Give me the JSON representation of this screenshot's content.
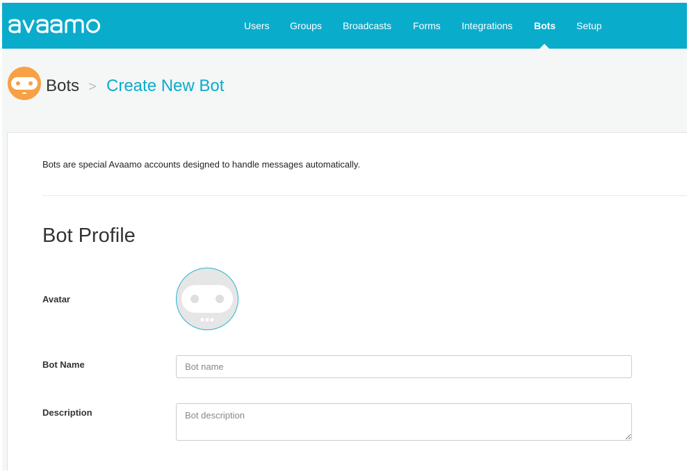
{
  "app": {
    "logo_text": "avaamo",
    "brand_color": "#0aaccc",
    "accent_orange": "#f7a144"
  },
  "nav": {
    "items": [
      {
        "label": "Users",
        "active": false
      },
      {
        "label": "Groups",
        "active": false
      },
      {
        "label": "Broadcasts",
        "active": false
      },
      {
        "label": "Forms",
        "active": false
      },
      {
        "label": "Integrations",
        "active": false
      },
      {
        "label": "Bots",
        "active": true
      },
      {
        "label": "Setup",
        "active": false
      }
    ]
  },
  "breadcrumb": {
    "icon": "bot-face-icon",
    "root": "Bots",
    "separator": ">",
    "current": "Create New Bot"
  },
  "content": {
    "intro": "Bots are special Avaamo accounts designed to handle messages automatically.",
    "section_title": "Bot Profile",
    "fields": {
      "avatar": {
        "label": "Avatar",
        "icon": "bot-avatar-icon"
      },
      "name": {
        "label": "Bot Name",
        "value": "",
        "placeholder": "Bot name"
      },
      "description": {
        "label": "Description",
        "value": "",
        "placeholder": "Bot description"
      }
    }
  }
}
